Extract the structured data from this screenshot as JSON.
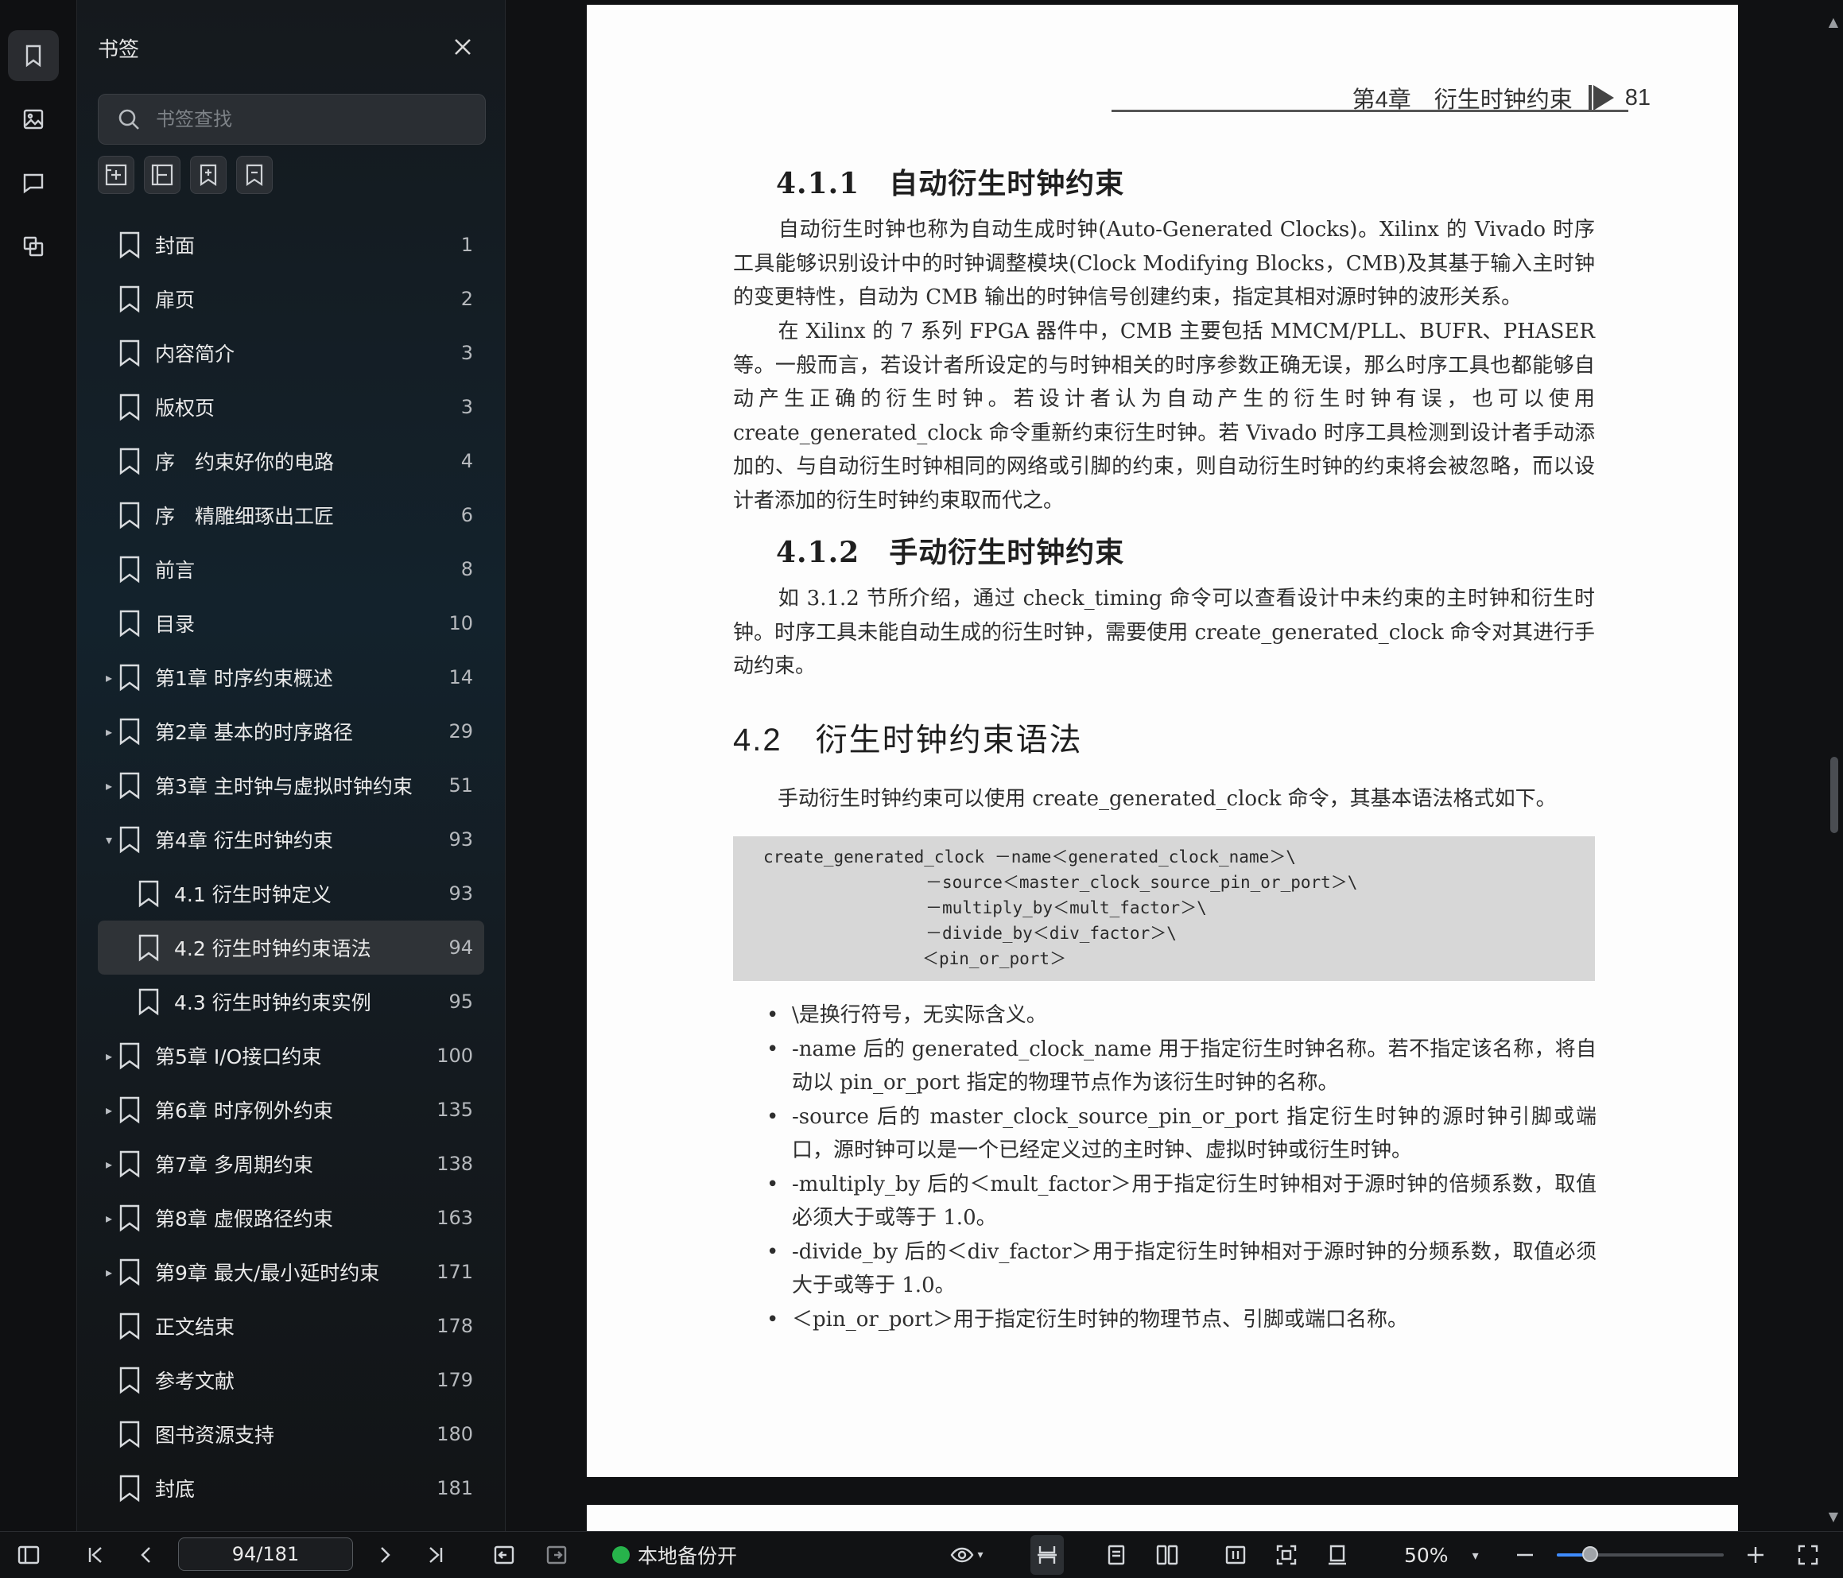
{
  "panel": {
    "title": "书签",
    "search_placeholder": "书签查找"
  },
  "bookmarks": [
    {
      "label": "封面",
      "page": "1",
      "level": 1,
      "arrow": ""
    },
    {
      "label": "扉页",
      "page": "2",
      "level": 1,
      "arrow": ""
    },
    {
      "label": "内容简介",
      "page": "3",
      "level": 1,
      "arrow": ""
    },
    {
      "label": "版权页",
      "page": "3",
      "level": 1,
      "arrow": ""
    },
    {
      "label": "序　约束好你的电路",
      "page": "4",
      "level": 1,
      "arrow": ""
    },
    {
      "label": "序　精雕细琢出工匠",
      "page": "6",
      "level": 1,
      "arrow": ""
    },
    {
      "label": "前言",
      "page": "8",
      "level": 1,
      "arrow": ""
    },
    {
      "label": "目录",
      "page": "10",
      "level": 1,
      "arrow": ""
    },
    {
      "label": "第1章 时序约束概述",
      "page": "14",
      "level": 1,
      "arrow": "▸"
    },
    {
      "label": "第2章 基本的时序路径",
      "page": "29",
      "level": 1,
      "arrow": "▸"
    },
    {
      "label": "第3章 主时钟与虚拟时钟约束",
      "page": "51",
      "level": 1,
      "arrow": "▸"
    },
    {
      "label": "第4章 衍生时钟约束",
      "page": "93",
      "level": 1,
      "arrow": "▾"
    },
    {
      "label": "4.1 衍生时钟定义",
      "page": "93",
      "level": 2,
      "arrow": ""
    },
    {
      "label": "4.2 衍生时钟约束语法",
      "page": "94",
      "level": 2,
      "arrow": "",
      "selected": true
    },
    {
      "label": "4.3 衍生时钟约束实例",
      "page": "95",
      "level": 2,
      "arrow": ""
    },
    {
      "label": "第5章 I/O接口约束",
      "page": "100",
      "level": 1,
      "arrow": "▸"
    },
    {
      "label": "第6章 时序例外约束",
      "page": "135",
      "level": 1,
      "arrow": "▸"
    },
    {
      "label": "第7章 多周期约束",
      "page": "138",
      "level": 1,
      "arrow": "▸"
    },
    {
      "label": "第8章 虚假路径约束",
      "page": "163",
      "level": 1,
      "arrow": "▸"
    },
    {
      "label": "第9章 最大/最小延时约束",
      "page": "171",
      "level": 1,
      "arrow": "▸"
    },
    {
      "label": "正文结束",
      "page": "178",
      "level": 1,
      "arrow": ""
    },
    {
      "label": "参考文献",
      "page": "179",
      "level": 1,
      "arrow": ""
    },
    {
      "label": "图书资源支持",
      "page": "180",
      "level": 1,
      "arrow": ""
    },
    {
      "label": "封底",
      "page": "181",
      "level": 1,
      "arrow": ""
    }
  ],
  "page": {
    "header_chapter": "第4章　衍生时钟约束",
    "header_page": "81",
    "s411_title": "4.1.1　自动衍生时钟约束",
    "s411_p1": "自动衍生时钟也称为自动生成时钟(Auto-Generated Clocks)。Xilinx 的 Vivado 时序工具能够识别设计中的时钟调整模块(Clock Modifying Blocks，CMB)及其基于输入主时钟的变更特性，自动为 CMB 输出的时钟信号创建约束，指定其相对源时钟的波形关系。",
    "s411_p2": "在 Xilinx 的 7 系列 FPGA 器件中，CMB 主要包括 MMCM/PLL、BUFR、PHASER 等。一般而言，若设计者所设定的与时钟相关的时序参数正确无误，那么时序工具也都能够自动产生正确的衍生时钟。若设计者认为自动产生的衍生时钟有误，也可以使用 create_generated_clock 命令重新约束衍生时钟。若 Vivado 时序工具检测到设计者手动添加的、与自动衍生时钟相同的网络或引脚的约束，则自动衍生时钟的约束将会被忽略，而以设计者添加的衍生时钟约束取而代之。",
    "s412_title": "4.1.2　手动衍生时钟约束",
    "s412_p1": "如 3.1.2 节所介绍，通过 check_timing 命令可以查看设计中未约束的主时钟和衍生时钟。时序工具未能自动生成的衍生时钟，需要使用 create_generated_clock 命令对其进行手动约束。",
    "s42_title": "4.2　衍生时钟约束语法",
    "s42_p1": "手动衍生时钟约束可以使用 create_generated_clock 命令，其基本语法格式如下。",
    "code": [
      "create_generated_clock －name＜generated_clock_name＞\\",
      "－source＜master_clock_source_pin_or_port＞\\",
      "－multiply_by＜mult_factor＞\\",
      "－divide_by＜div_factor＞\\",
      "＜pin_or_port＞"
    ],
    "bullets": [
      "\\是换行符号，无实际含义。",
      "-name 后的 generated_clock_name 用于指定衍生时钟名称。若不指定该名称，将自动以 pin_or_port 指定的物理节点作为该衍生时钟的名称。",
      "-source 后的 master_clock_source_pin_or_port 指定衍生时钟的源时钟引脚或端口，源时钟可以是一个已经定义过的主时钟、虚拟时钟或衍生时钟。",
      "-multiply_by 后的＜mult_factor＞用于指定衍生时钟相对于源时钟的倍频系数，取值必须大于或等于 1.0。",
      "-divide_by 后的＜div_factor＞用于指定衍生时钟相对于源时钟的分频系数，取值必须大于或等于 1.0。",
      "＜pin_or_port＞用于指定衍生时钟的物理节点、引脚或端口名称。"
    ]
  },
  "bottombar": {
    "page_indicator": "94/181",
    "backup_label": "本地备份开",
    "zoom_label": "50%",
    "zoom_level": 0.2
  },
  "colors": {
    "accent": "#3f8cff",
    "backup_dot": "#27b34b"
  }
}
